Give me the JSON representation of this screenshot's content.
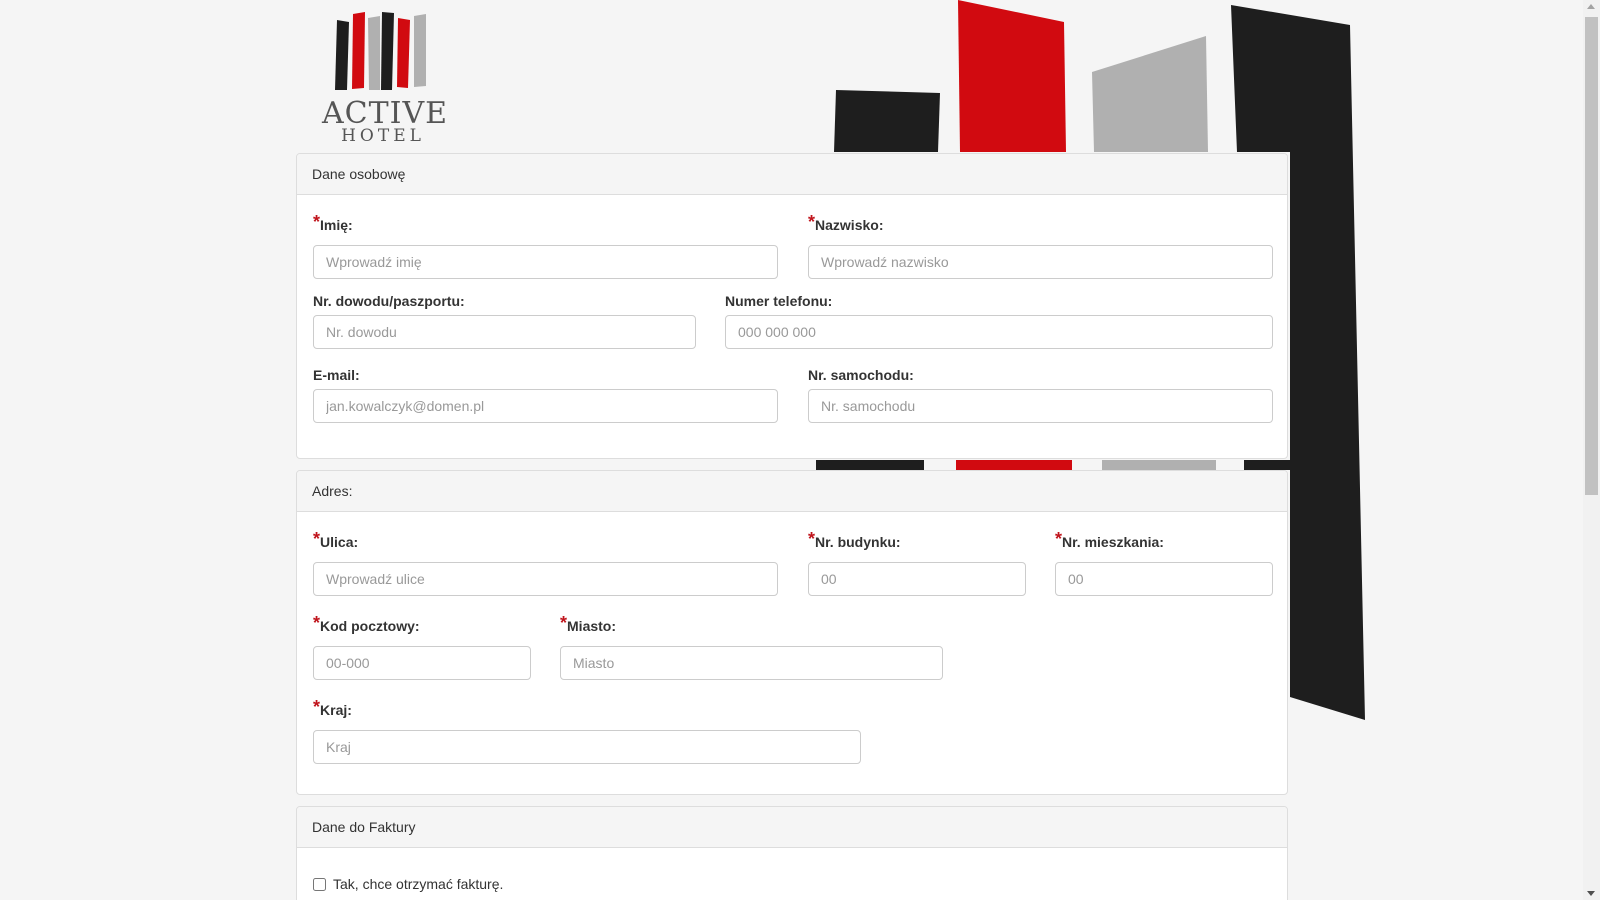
{
  "brand": {
    "name_top": "ACTIVE",
    "name_bottom": "HOTEL",
    "colors": {
      "red": "#d10a10",
      "black": "#1e1e1e",
      "gray": "#b0b0b0"
    }
  },
  "personal": {
    "heading": "Dane osobowę",
    "first_name": {
      "label": "Imię:",
      "placeholder": "Wprowadź imię",
      "required": "*"
    },
    "last_name": {
      "label": "Nazwisko:",
      "placeholder": "Wprowadź nazwisko",
      "required": "*"
    },
    "id_number": {
      "label": "Nr. dowodu/paszportu:",
      "placeholder": "Nr. dowodu"
    },
    "phone": {
      "label": "Numer telefonu:",
      "placeholder": "000 000 000"
    },
    "email": {
      "label": "E-mail:",
      "placeholder": "jan.kowalczyk@domen.pl"
    },
    "car_number": {
      "label": "Nr. samochodu:",
      "placeholder": "Nr. samochodu"
    }
  },
  "address": {
    "heading": "Adres:",
    "street": {
      "label": "Ulica:",
      "placeholder": "Wprowadź ulice",
      "required": "*"
    },
    "building": {
      "label": "Nr. budynku:",
      "placeholder": "00",
      "required": "*"
    },
    "apartment": {
      "label": "Nr. mieszkania:",
      "placeholder": "00",
      "required": "*"
    },
    "postal_code": {
      "label": "Kod pocztowy:",
      "placeholder": "00-000",
      "required": "*"
    },
    "city": {
      "label": "Miasto:",
      "placeholder": "Miasto",
      "required": "*"
    },
    "country": {
      "label": "Kraj:",
      "placeholder": "Kraj",
      "required": "*"
    }
  },
  "invoice": {
    "heading": "Dane do Faktury",
    "checkbox_label": "Tak, chce otrzymać fakturę."
  }
}
